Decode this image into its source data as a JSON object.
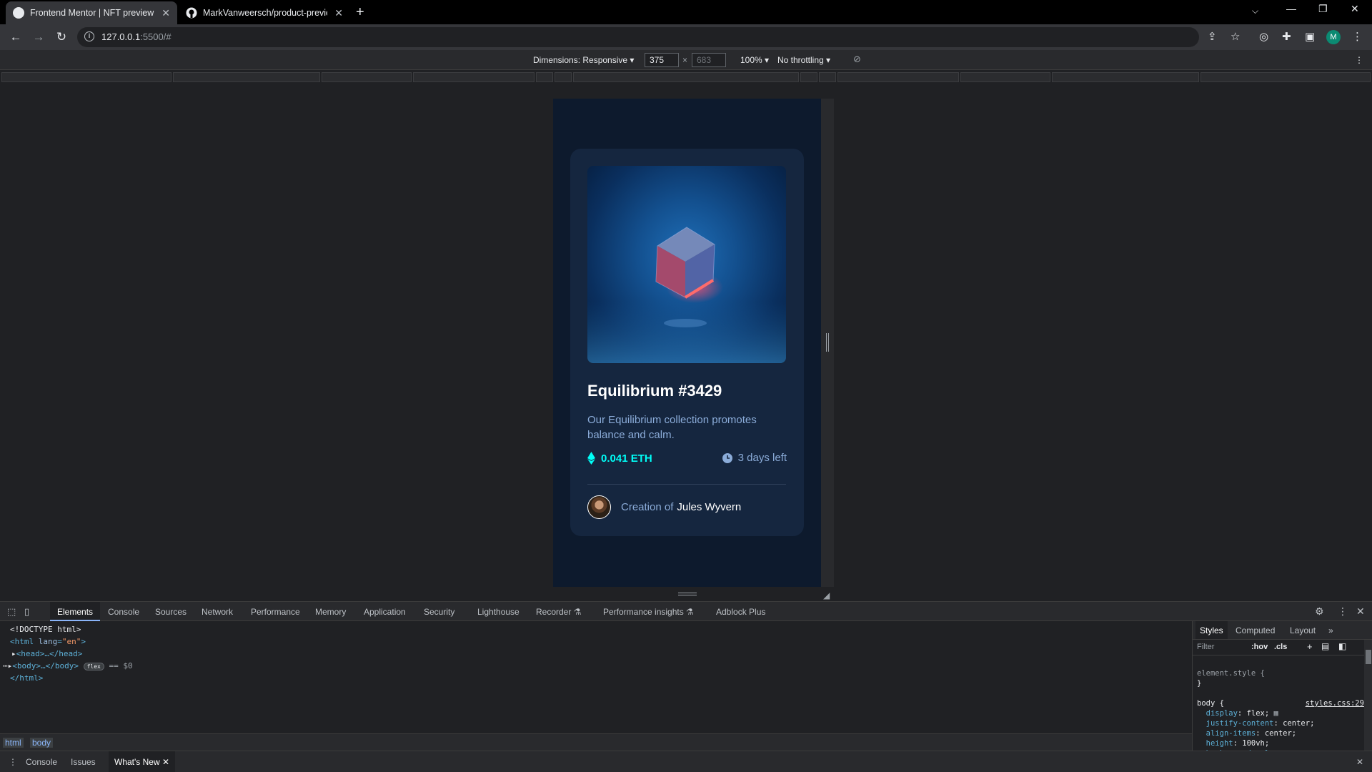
{
  "browser": {
    "tabs": [
      {
        "title": "Frontend Mentor | NFT preview c",
        "active": true
      },
      {
        "title": "MarkVanweersch/product-previe",
        "active": false
      }
    ],
    "url_host": "127.0.0.1",
    "url_rest": ":5500/#"
  },
  "device_toolbar": {
    "dimensions_label": "Dimensions: Responsive ▾",
    "width": "375",
    "height": "683",
    "zoom": "100% ▾",
    "throttling": "No throttling ▾"
  },
  "nft_card": {
    "title": "Equilibrium #3429",
    "description": "Our Equilibrium collection promotes balance and calm.",
    "price": "0.041 ETH",
    "time_left": "3 days left",
    "creator_prefix": "Creation of",
    "creator_name": "Jules Wyvern"
  },
  "devtools": {
    "tabs": [
      "Elements",
      "Console",
      "Sources",
      "Network",
      "Performance",
      "Memory",
      "Application",
      "Security",
      "Lighthouse",
      "Recorder ⚗",
      "Performance insights ⚗",
      "Adblock Plus"
    ],
    "dom": {
      "doctype": "<!DOCTYPE html>",
      "html_open_tag": "<html ",
      "html_attr": "lang",
      "html_attr_val": "\"en\"",
      "head": "<head>…</head>",
      "body": "<body>…</body>",
      "flex_badge": "flex",
      "selected_marker": "== $0",
      "html_close": "</html>"
    },
    "breadcrumbs": [
      "html",
      "body"
    ],
    "styles_tabs": [
      "Styles",
      "Computed",
      "Layout"
    ],
    "filter_placeholder": "Filter",
    "hov": ":hov",
    "cls": ".cls",
    "styles_code": {
      "element_style_open": "element.style {",
      "element_style_close": "}",
      "body_selector": "body {",
      "source": "styles.css:29",
      "rules": [
        {
          "prop": "display",
          "val": "flex;"
        },
        {
          "prop": "justify-content",
          "val": "center;"
        },
        {
          "prop": "align-items",
          "val": "center;"
        },
        {
          "prop": "height",
          "val": "100vh;"
        },
        {
          "prop": "background-color",
          "val": ""
        }
      ]
    },
    "drawer_tabs": [
      "Console",
      "Issues",
      "What's New"
    ]
  }
}
